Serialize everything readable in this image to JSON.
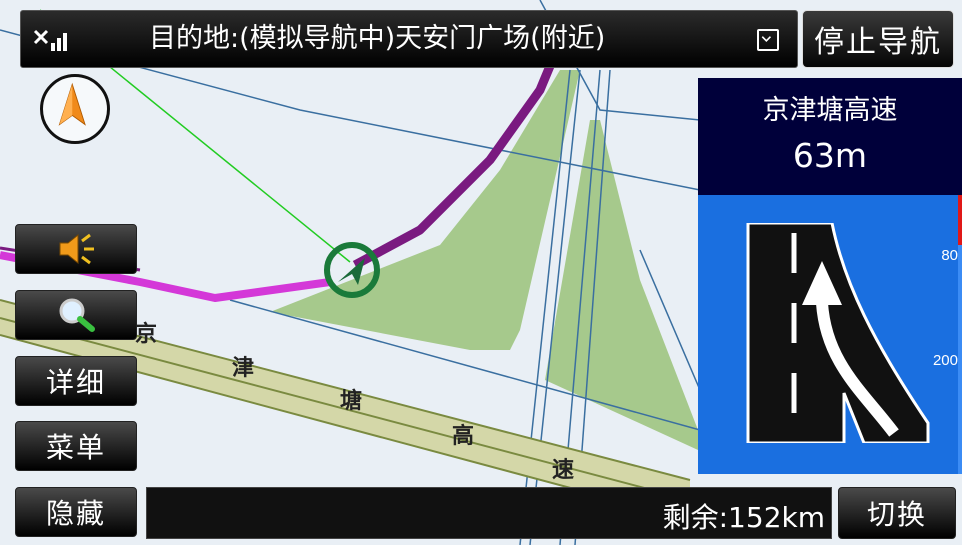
{
  "header": {
    "signal_icon": "signal-icon",
    "destination_text": "目的地:(模拟导航中)天安门广场(附近)",
    "dropdown_icon": "dropdown-icon",
    "stop_button_label": "停止导航"
  },
  "sidebar": {
    "sound_icon": "speaker-icon",
    "search_icon": "magnifier-icon",
    "detail_label": "详细",
    "menu_label": "菜单",
    "hide_label": "隐藏"
  },
  "map": {
    "road_chars": [
      "京",
      "津",
      "塘",
      "高",
      "速"
    ]
  },
  "guidance": {
    "road_name": "京津塘高速",
    "distance": "63m",
    "scale_ticks": [
      "80",
      "200"
    ],
    "lane_icon": "merge-right-lane-icon",
    "colors": {
      "panel_top": "#00003a",
      "panel_bottom": "#1a6fe0",
      "route": "#7a1a80"
    }
  },
  "footer": {
    "remaining_text": "剩余:152km",
    "switch_label": "切换"
  }
}
